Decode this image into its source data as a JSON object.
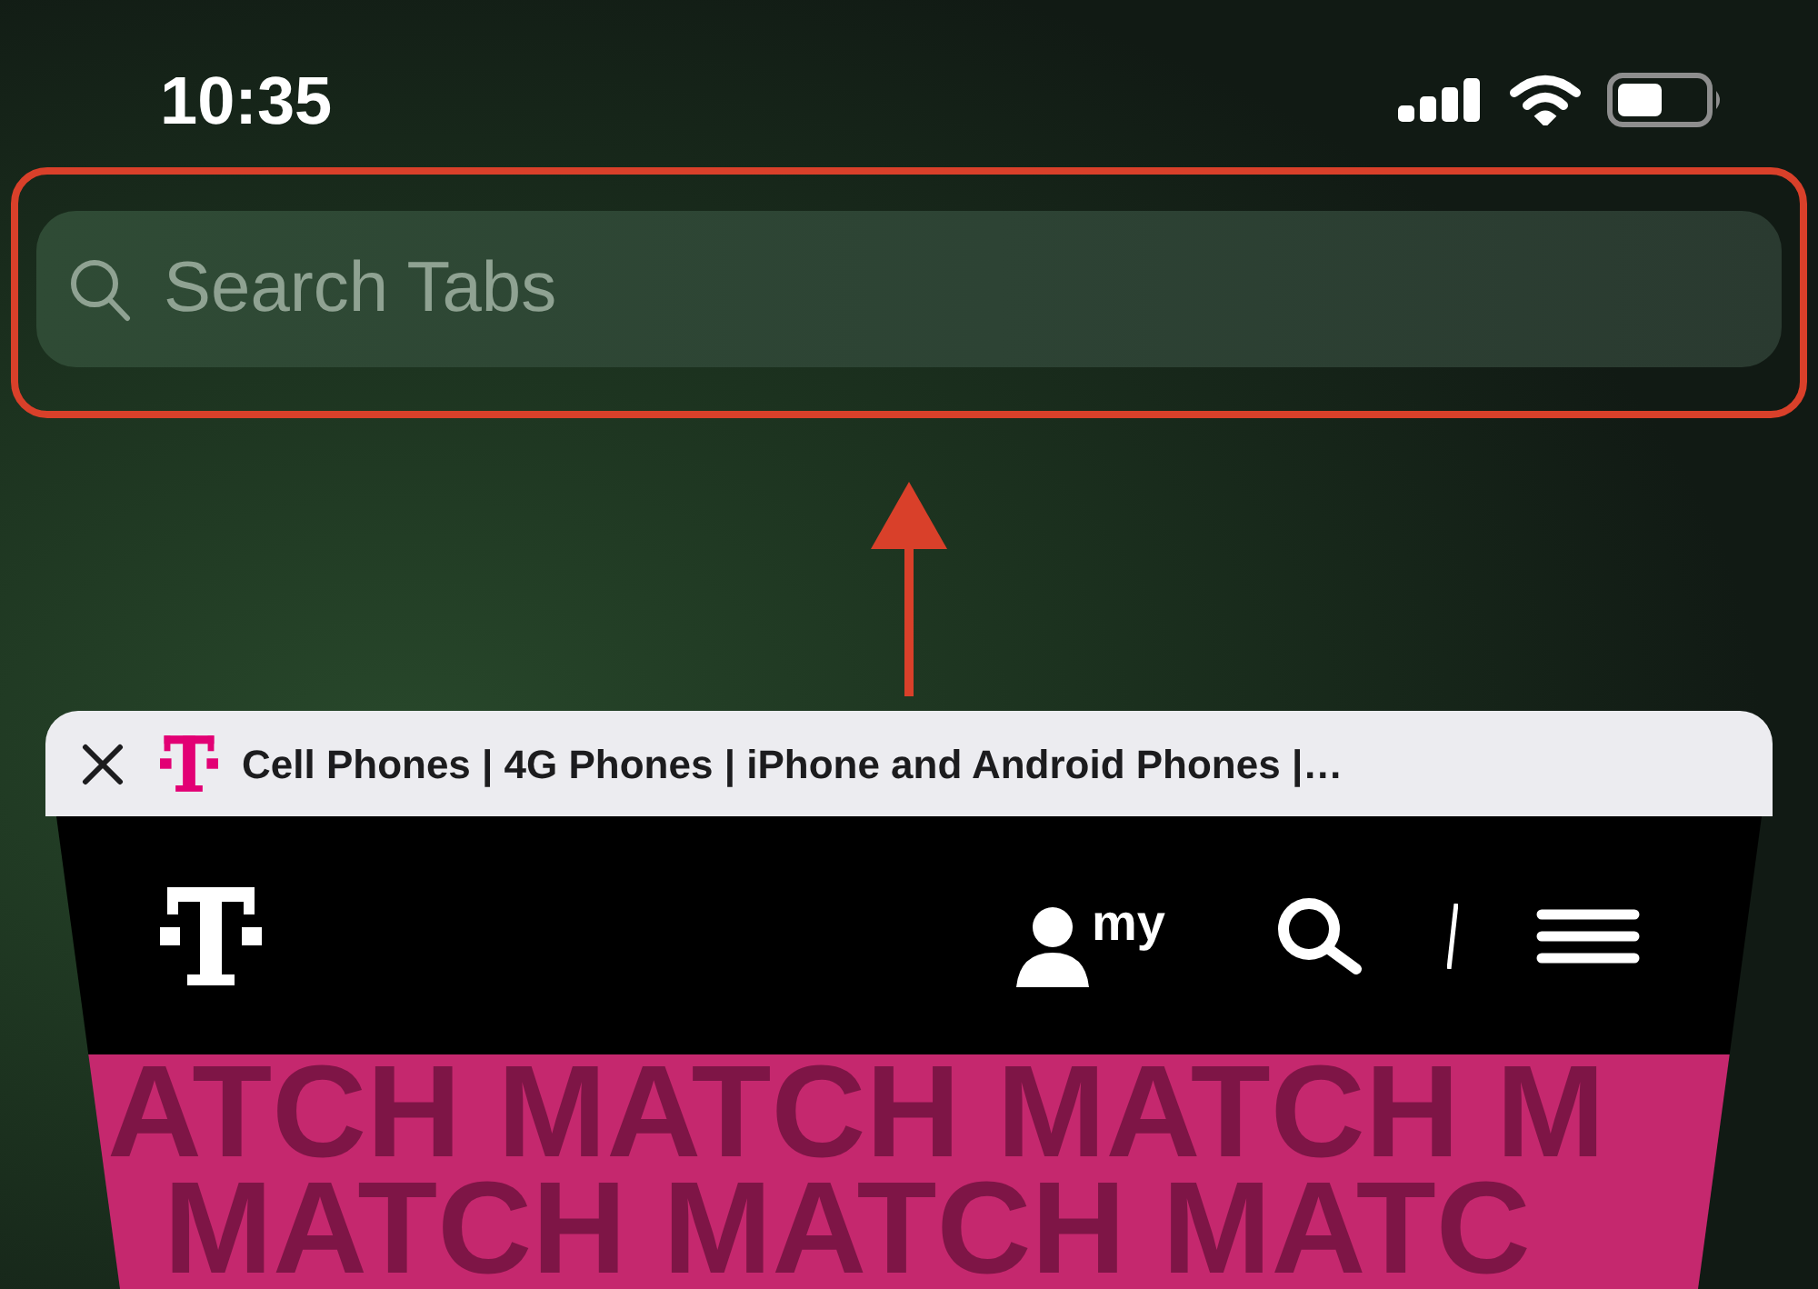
{
  "status_bar": {
    "time": "10:35"
  },
  "search_bar": {
    "placeholder": "Search Tabs",
    "highlighted": true
  },
  "tab": {
    "title": "Cell Phones | 4G Phones | iPhone and Android Phones |…",
    "page": {
      "account_label": "my",
      "banner_lines": [
        "ATCH MATCH MATCH M",
        "MATCH MATCH MATC"
      ]
    }
  }
}
